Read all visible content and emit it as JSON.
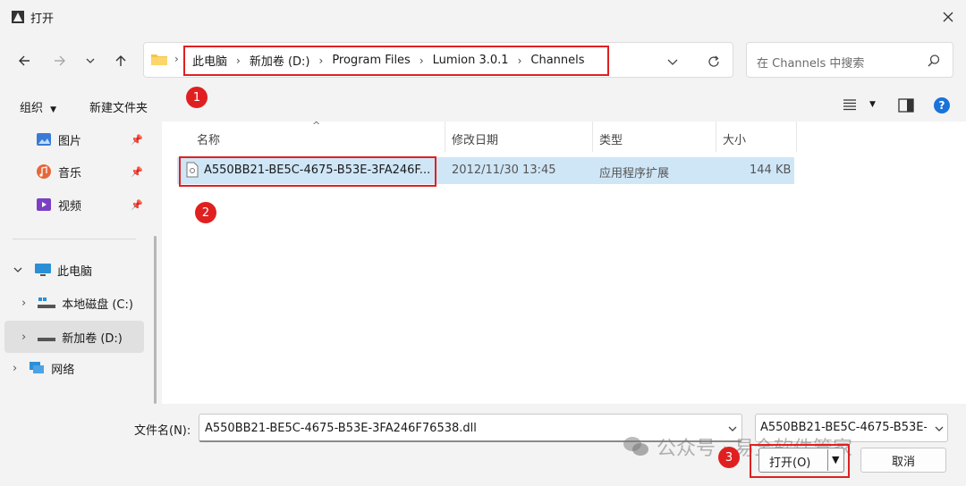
{
  "window": {
    "title": "打开"
  },
  "address": {
    "crumbs": [
      "此电脑",
      "新加卷 (D:)",
      "Program Files",
      "Lumion 3.0.1",
      "Channels"
    ]
  },
  "search": {
    "placeholder": "在 Channels 中搜索"
  },
  "toolbar": {
    "organize_label": "组织",
    "new_folder_label": "新建文件夹"
  },
  "nav": {
    "quick": [
      {
        "label": "图片",
        "icon": "pictures-icon"
      },
      {
        "label": "音乐",
        "icon": "music-icon"
      },
      {
        "label": "视频",
        "icon": "videos-icon"
      }
    ],
    "this_pc": "此电脑",
    "drives": [
      {
        "label": "本地磁盘 (C:)"
      },
      {
        "label": "新加卷 (D:)",
        "selected": true
      }
    ],
    "network": "网络"
  },
  "columns": {
    "name": "名称",
    "modified": "修改日期",
    "type": "类型",
    "size": "大小"
  },
  "files": [
    {
      "name": "A550BB21-BE5C-4675-B53E-3FA246F...",
      "modified": "2012/11/30 13:45",
      "type": "应用程序扩展",
      "size": "144 KB"
    }
  ],
  "bottom": {
    "filename_label": "文件名(N):",
    "filename_value": "A550BB21-BE5C-4675-B53E-3FA246F76538.dll",
    "filter_value": "A550BB21-BE5C-4675-B53E-",
    "open_label": "打开(O)",
    "cancel_label": "取消"
  },
  "annotations": {
    "badge1": "1",
    "badge2": "2",
    "badge3": "3"
  },
  "watermark": "公众号 · 易全软件管家",
  "colors": {
    "highlight": "#e02020",
    "selection": "#cfe6f7",
    "accent": "#1a73d9"
  }
}
